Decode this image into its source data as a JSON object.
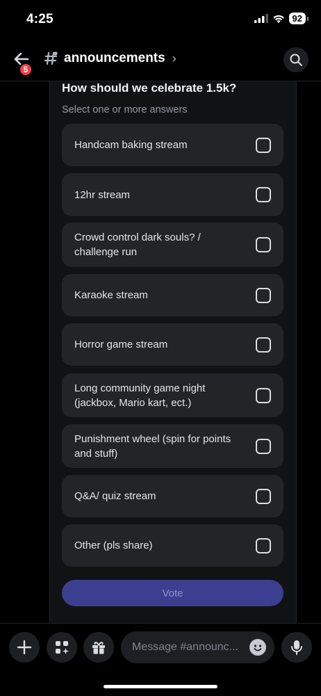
{
  "status": {
    "time": "4:25",
    "battery": "92"
  },
  "header": {
    "badge_count": "5",
    "channel_name": "announcements"
  },
  "poll": {
    "question": "How should we celebrate 1.5k?",
    "subtitle": "Select one or more answers",
    "answers": [
      "Handcam baking stream",
      "12hr stream",
      "Crowd control dark souls? / challenge run",
      "Karaoke stream",
      "Horror game stream",
      "Long community game night (jackbox, Mario kart, ect.)",
      "Punishment wheel (spin for points and stuff)",
      "Q&A/ quiz stream",
      "Other (pls share)"
    ],
    "vote_label": "Vote"
  },
  "composer": {
    "placeholder": "Message #announc..."
  },
  "colors": {
    "accent": "#5865f2",
    "vote_disabled": "#3c3f8f",
    "badge": "#f23f43"
  },
  "icons": [
    "back-arrow-icon",
    "hash-icon",
    "search-icon",
    "plus-icon",
    "apps-icon",
    "gift-icon",
    "emoji-icon",
    "microphone-icon"
  ]
}
